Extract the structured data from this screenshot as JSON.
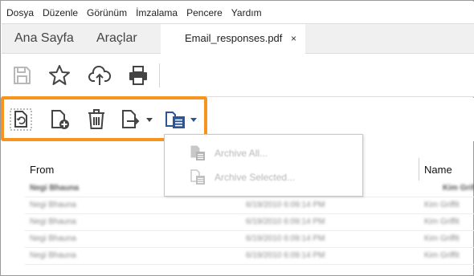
{
  "menu": {
    "items": [
      "Dosya",
      "Düzenle",
      "Görünüm",
      "İmzalama",
      "Pencere",
      "Yardım"
    ]
  },
  "tabs": {
    "home": "Ana Sayfa",
    "tools": "Araçlar",
    "file": "Email_responses.pdf",
    "close": "×"
  },
  "toolbar": {
    "icons": [
      "save-icon",
      "bookmark-star-icon",
      "cloud-upload-icon",
      "print-icon"
    ]
  },
  "subtoolbar": {
    "icons": [
      "refresh-document-icon",
      "add-document-icon",
      "trash-icon",
      "export-document-icon",
      "archive-document-icon"
    ],
    "highlight_color": "#f7941d"
  },
  "dropdown": {
    "items": [
      "Archive All...",
      "Archive Selected..."
    ]
  },
  "table": {
    "columns": [
      "From",
      "Name"
    ],
    "rows": [
      {
        "from": "Negi Bhauna",
        "date": "6/19/2010 6:09:14 PM",
        "name": "Kim Griffit"
      },
      {
        "from": "Negi Bhauna",
        "date": "6/19/2010 6:09:14 PM",
        "name": "Kim Griffit"
      },
      {
        "from": "Negi Bhauna",
        "date": "6/19/2010 6:09:14 PM",
        "name": "Kim Griffit"
      },
      {
        "from": "Negi Bhauna",
        "date": "6/19/2010 6:09:14 PM",
        "name": "Kim Griffit"
      },
      {
        "from": "Negi Bhauna",
        "date": "6/19/2010 6:09:14 PM",
        "name": "Kim Griffit"
      }
    ]
  }
}
